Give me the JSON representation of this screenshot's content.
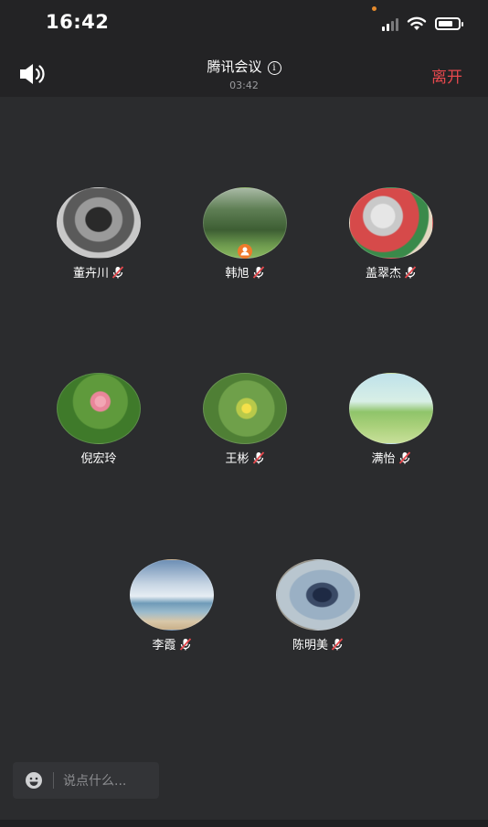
{
  "status_bar": {
    "time": "16:42"
  },
  "header": {
    "title": "腾讯会议",
    "timer": "03:42",
    "leave_label": "离开"
  },
  "participants": [
    {
      "name": "董卉川",
      "muted": true,
      "host": false
    },
    {
      "name": "韩旭",
      "muted": true,
      "host": true
    },
    {
      "name": "盖翠杰",
      "muted": true,
      "host": false
    },
    {
      "name": "倪宏玲",
      "muted": false,
      "host": false
    },
    {
      "name": "王彬",
      "muted": true,
      "host": false
    },
    {
      "name": "满怡",
      "muted": true,
      "host": false
    },
    {
      "name": "李霞",
      "muted": true,
      "host": false
    },
    {
      "name": "陈明美",
      "muted": true,
      "host": false
    }
  ],
  "chat": {
    "placeholder": "说点什么..."
  },
  "colors": {
    "background": "#2b2c2e",
    "header_background": "#232325",
    "leave": "#e5484d",
    "host_badge": "#f07a2a"
  },
  "icons": {
    "speaker": "speaker-icon",
    "info": "info-icon",
    "mic_muted": "mic-muted-icon",
    "emoji": "emoji-icon",
    "host": "host-icon"
  }
}
